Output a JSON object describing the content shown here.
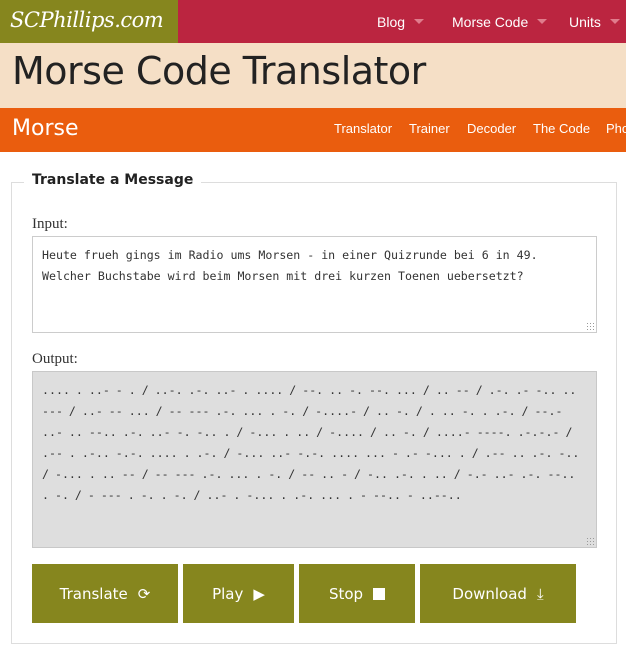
{
  "site": {
    "logo": "SCPhillips.com",
    "nav": [
      "Blog",
      "Morse Code",
      "Units"
    ]
  },
  "page_title": "Morse Code Translator",
  "section": {
    "brand": "Morse",
    "nav": [
      "Translator",
      "Trainer",
      "Decoder",
      "The Code",
      "Pho"
    ]
  },
  "form": {
    "legend": "Translate a Message",
    "input_label": "Input:",
    "input_value": "Heute frueh gings im Radio ums Morsen - in einer Quizrunde bei 6 in 49. Welcher Buchstabe wird beim Morsen mit drei kurzen Toenen uebersetzt?",
    "output_label": "Output:",
    "output_value": ".... . ..- - . / ..-. .-. ..- . .... / --. .. -. --. ... / .. -- / .-. .- -.. .. --- / ..- -- ... / -- --- .-. ... . -. / -....- / .. -. / . .. -. . .-. / --.- ..- .. --.. .-. ..- -. -.. . / -... . .. / -.... / .. -. / ....- ----. .-.-.- / .-- . .-.. -.-. .... . .-. / -... ..- -.-. .... ... - .- -... . / .-- .. .-. -.. / -... . .. -- / -- --- .-. ... . -. / -- .. - / -.. .-. . .. / -.- ..- .-. --.. . -. / - --- . -. . -. / ..- . -... . .-. ... . - --.. - ..--..",
    "buttons": {
      "translate": "Translate",
      "play": "Play",
      "stop": "Stop",
      "download": "Download"
    }
  },
  "colors": {
    "olive": "#86861e",
    "crimson": "#bb2540",
    "peach": "#f5dfc6",
    "orange": "#ea5d0e"
  }
}
